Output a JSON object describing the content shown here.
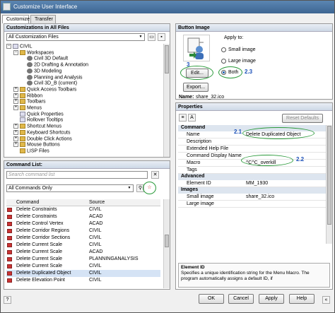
{
  "window": {
    "title": "Customize User Interface"
  },
  "tabs": [
    "Customize",
    "Transfer"
  ],
  "customizations": {
    "header": "Customizations in All Files",
    "filter": "All Customization Files",
    "tree": [
      {
        "label": "CIVIL",
        "level": 0,
        "exp": "-",
        "icon": "doc"
      },
      {
        "label": "Workspaces",
        "level": 1,
        "exp": "-",
        "icon": "folder"
      },
      {
        "label": "Civil 3D Default",
        "level": 2,
        "exp": "",
        "icon": "gear"
      },
      {
        "label": "2D Drafting & Annotation",
        "level": 2,
        "exp": "",
        "icon": "gear"
      },
      {
        "label": "3D Modeling",
        "level": 2,
        "exp": "",
        "icon": "gear"
      },
      {
        "label": "Planning and Analysis",
        "level": 2,
        "exp": "",
        "icon": "gear"
      },
      {
        "label": "Civil 3D_B (current)",
        "level": 2,
        "exp": "",
        "icon": "gear"
      },
      {
        "label": "Quick Access Toolbars",
        "level": 1,
        "exp": "+",
        "icon": "folder"
      },
      {
        "label": "Ribbon",
        "level": 1,
        "exp": "+",
        "icon": "folder"
      },
      {
        "label": "Toolbars",
        "level": 1,
        "exp": "+",
        "icon": "folder"
      },
      {
        "label": "Menus",
        "level": 1,
        "exp": "+",
        "icon": "folder"
      },
      {
        "label": "Quick Properties",
        "level": 1,
        "exp": "",
        "icon": "doc"
      },
      {
        "label": "Rollover Tooltips",
        "level": 1,
        "exp": "",
        "icon": "doc"
      },
      {
        "label": "Shortcut Menus",
        "level": 1,
        "exp": "+",
        "icon": "folder"
      },
      {
        "label": "Keyboard Shortcuts",
        "level": 1,
        "exp": "+",
        "icon": "folder"
      },
      {
        "label": "Double Click Actions",
        "level": 1,
        "exp": "+",
        "icon": "folder"
      },
      {
        "label": "Mouse Buttons",
        "level": 1,
        "exp": "+",
        "icon": "folder"
      },
      {
        "label": "LISP Files",
        "level": 1,
        "exp": "",
        "icon": "folder"
      }
    ]
  },
  "command_list": {
    "header": "Command List:",
    "search_placeholder": "Search command list",
    "filter": "All Commands Only",
    "columns": [
      "Command",
      "Source"
    ],
    "rows": [
      {
        "command": "Delete Constraints",
        "source": "CIVIL"
      },
      {
        "command": "Delete Constraints",
        "source": "ACAD"
      },
      {
        "command": "Delete Control Vertex",
        "source": "ACAD"
      },
      {
        "command": "Delete Corridor Regions",
        "source": "CIVIL"
      },
      {
        "command": "Delete Corridor Sections",
        "source": "CIVIL"
      },
      {
        "command": "Delete Current Scale",
        "source": "CIVIL"
      },
      {
        "command": "Delete Current Scale",
        "source": "ACAD"
      },
      {
        "command": "Delete Current Scale",
        "source": "PLANNINGANALYSIS"
      },
      {
        "command": "Delete Current Scale",
        "source": "CIVIL"
      },
      {
        "command": "Delete Duplicated Object",
        "source": "CIVIL"
      },
      {
        "command": "Delete Elevation Point",
        "source": "CIVIL"
      }
    ],
    "selected_index": 9
  },
  "button_image": {
    "header": "Button Image",
    "apply_to_label": "Apply to:",
    "options": [
      "Small image",
      "Large image",
      "Both"
    ],
    "selected": "Both",
    "edit_label": "Edit...",
    "export_label": "Export...",
    "name_label": "Name:",
    "name_value": "share_32.ico"
  },
  "properties": {
    "header": "Properties",
    "reset_label": "Reset Defaults",
    "sections": [
      {
        "title": "Command",
        "rows": [
          {
            "name": "Name",
            "value": "Delete Duplicated Object"
          },
          {
            "name": "Description",
            "value": ""
          },
          {
            "name": "Extended Help File",
            "value": ""
          },
          {
            "name": "Command Display Name",
            "value": ""
          },
          {
            "name": "Macro",
            "value": "^C^C_overkill"
          },
          {
            "name": "Tags",
            "value": ""
          }
        ]
      },
      {
        "title": "Advanced",
        "rows": [
          {
            "name": "Element ID",
            "value": "MM_1930"
          }
        ]
      },
      {
        "title": "Images",
        "rows": [
          {
            "name": "Small image",
            "value": "share_32.ico"
          },
          {
            "name": "Large image",
            "value": ""
          }
        ]
      }
    ],
    "help_title": "Element ID",
    "help_text": "Specifies a unique identification string for the Menu Macro. The program automatically assigns a default ID, if"
  },
  "annotations": {
    "n3": "3",
    "n23": "2.3",
    "n21": "2.1",
    "n22": "2.2"
  },
  "footer": {
    "ok": "OK",
    "cancel": "Cancel",
    "apply": "Apply",
    "help": "Help"
  },
  "colors": {
    "title_bar": "#3d6591",
    "callout": "#1a4fb8",
    "highlight_ring": "#2a9a3a"
  },
  "icons": {
    "dialog": "customize-icon",
    "new_command": "star-icon",
    "filter": "filter-icon"
  }
}
